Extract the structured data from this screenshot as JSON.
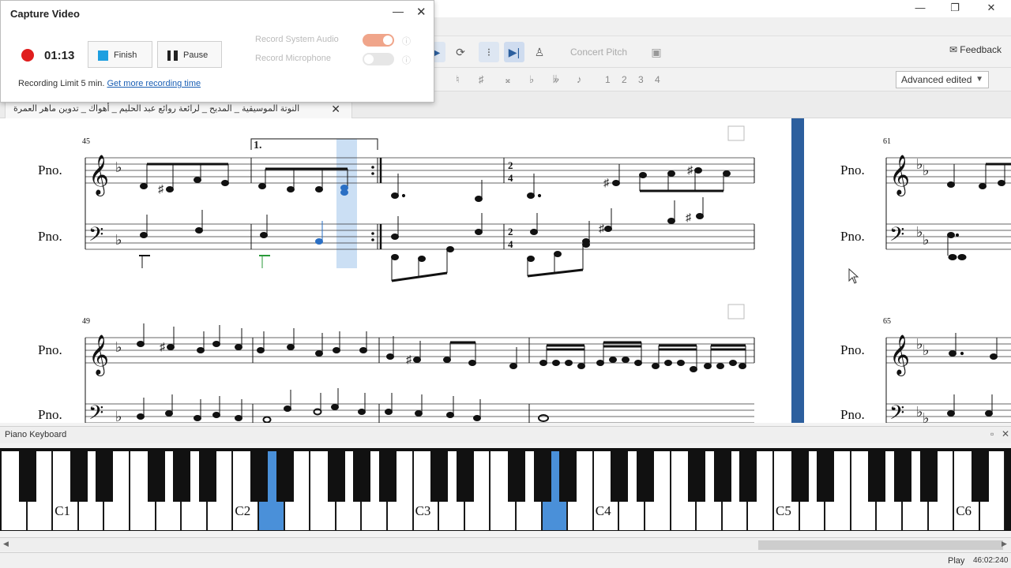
{
  "capture": {
    "title": "Capture Video",
    "minimize": "—",
    "close": "✕",
    "timer": "01:13",
    "finish_label": "Finish",
    "pause_label": "Pause",
    "system_audio_label": "Record System Audio",
    "microphone_label": "Record Microphone",
    "limit_text": "Recording Limit 5 min.",
    "limit_link": "Get more recording time",
    "colors": {
      "record": "#e01e1e",
      "toggle_on": "#f0a58a",
      "finish_icon": "#1e9fe0"
    }
  },
  "window": {
    "minimize": "—",
    "restore": "❐",
    "close": "✕"
  },
  "toolbar": {
    "concert_pitch": "Concert Pitch",
    "feedback": "Feedback",
    "voices": [
      "1",
      "2",
      "3",
      "4"
    ],
    "workspace": "Advanced edited"
  },
  "tab": {
    "title": "النوتة الموسيقية _ المديح _ لرائعة روائع عبد الحليم _ أهواك _ تدوين ماهر العمرة",
    "close": "✕"
  },
  "score": {
    "instrument": "Pno.",
    "bar_numbers": [
      "45",
      "49",
      "61",
      "65"
    ],
    "volta": "1."
  },
  "piano": {
    "title": "Piano Keyboard",
    "labels": [
      "C1",
      "C2",
      "C3",
      "C4",
      "C5",
      "C6"
    ],
    "highlight_color": "#4a90d9"
  },
  "status": {
    "mode": "Play",
    "time": "46:02:240"
  }
}
